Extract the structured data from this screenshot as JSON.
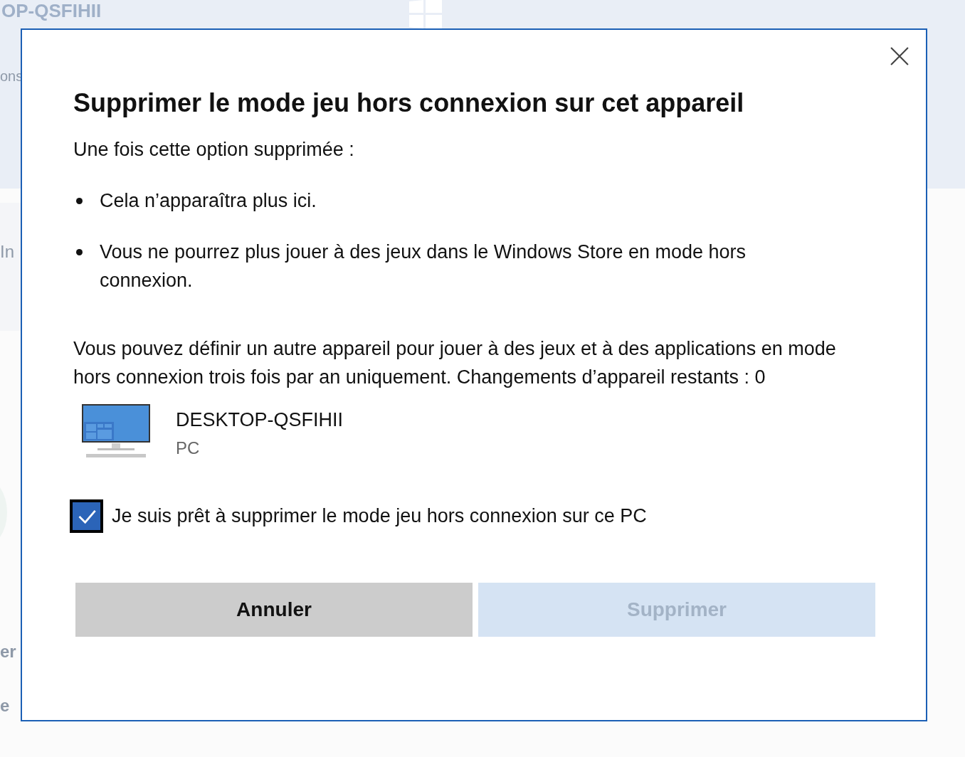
{
  "background": {
    "header_title": "OP-QSFIHII",
    "labels": [
      "ons",
      "In",
      "er",
      "e"
    ]
  },
  "dialog": {
    "title": "Supprimer le mode jeu hors connexion sur cet appareil",
    "intro": "Une fois cette option supprimée :",
    "bullets": [
      "Cela n’apparaîtra plus ici.",
      "Vous ne pourrez plus jouer à des jeux dans le Windows Store en mode hors connexion."
    ],
    "paragraph": "Vous pouvez définir un autre appareil pour jouer à des jeux et à des applications en mode hors connexion trois fois par an uniquement. Changements d’appareil restants : 0",
    "device": {
      "name": "DESKTOP-QSFIHII",
      "type": "PC"
    },
    "confirm": {
      "label": "Je suis prêt à supprimer le mode jeu hors connexion sur ce PC",
      "checked": true
    },
    "buttons": [
      {
        "label": "Annuler",
        "kind": "secondary",
        "disabled": false
      },
      {
        "label": "Supprimer",
        "kind": "primary",
        "disabled": true
      }
    ]
  }
}
